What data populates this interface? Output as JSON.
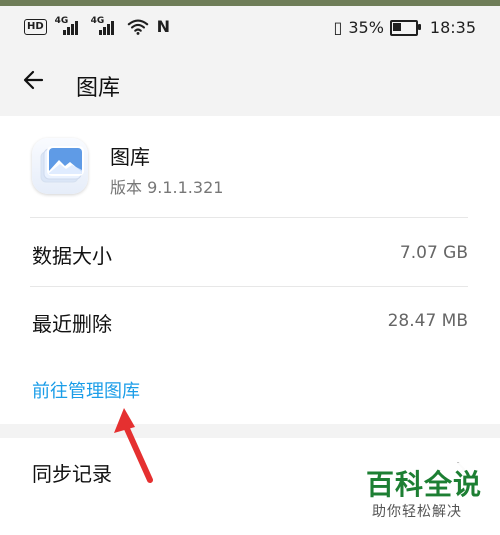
{
  "status_bar": {
    "hd_label": "HD",
    "network_1": "4G",
    "network_2": "4G",
    "nfc_label": "N",
    "battery_percent": "35%",
    "battery_level": 0.35,
    "time": "18:35"
  },
  "header": {
    "title": "图库"
  },
  "app": {
    "name": "图库",
    "version": "版本 9.1.1.321"
  },
  "storage": {
    "data_size_label": "数据大小",
    "data_size_value": "7.07 GB",
    "recently_deleted_label": "最近删除",
    "recently_deleted_value": "28.47 MB",
    "manage_link": "前往管理图库"
  },
  "sync": {
    "label": "同步记录"
  },
  "watermark": {
    "main": "百科全说",
    "sub": "助你轻松解决"
  },
  "colors": {
    "accent_link": "#1a9de8",
    "annotation_arrow": "#e53030",
    "watermark_green": "#1d7f33"
  },
  "icons": {
    "back": "back-arrow-icon",
    "app": "gallery-app-icon",
    "wifi": "wifi-icon",
    "battery": "battery-icon",
    "chevron": "chevron-right-icon"
  }
}
